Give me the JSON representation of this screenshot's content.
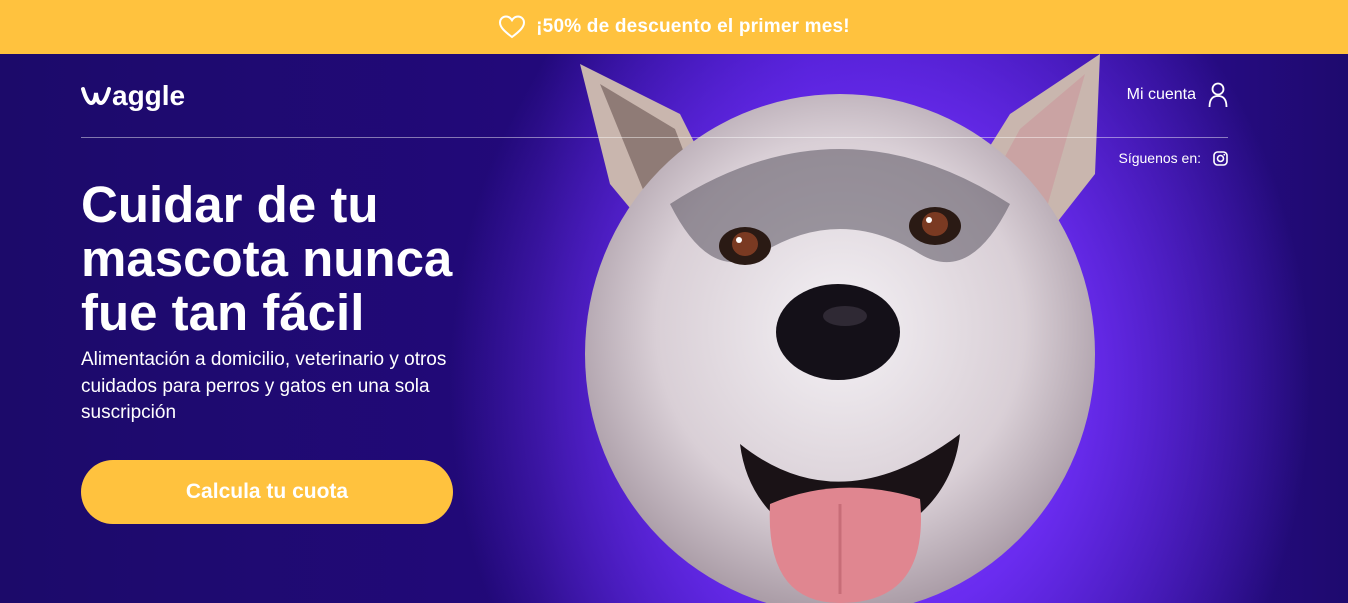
{
  "promo": {
    "text": "¡50% de descuento el primer mes!",
    "icon": "heart-icon"
  },
  "header": {
    "logo_text": "aggle",
    "account_label": "Mi cuenta",
    "account_icon": "user-icon",
    "follow_label": "Síguenos en:",
    "social_icon": "instagram-icon"
  },
  "hero": {
    "headline": "Cuidar de tu mascota nunca fue tan fácil",
    "subtitle": "Alimentación a domicilio, veterinario y otros cuidados para perros y gatos en una sola suscripción",
    "cta_label": "Calcula tu cuota"
  },
  "colors": {
    "accent": "#ffc23e",
    "background": "#1e0a6e",
    "highlight": "#7a3cff",
    "text": "#ffffff"
  }
}
